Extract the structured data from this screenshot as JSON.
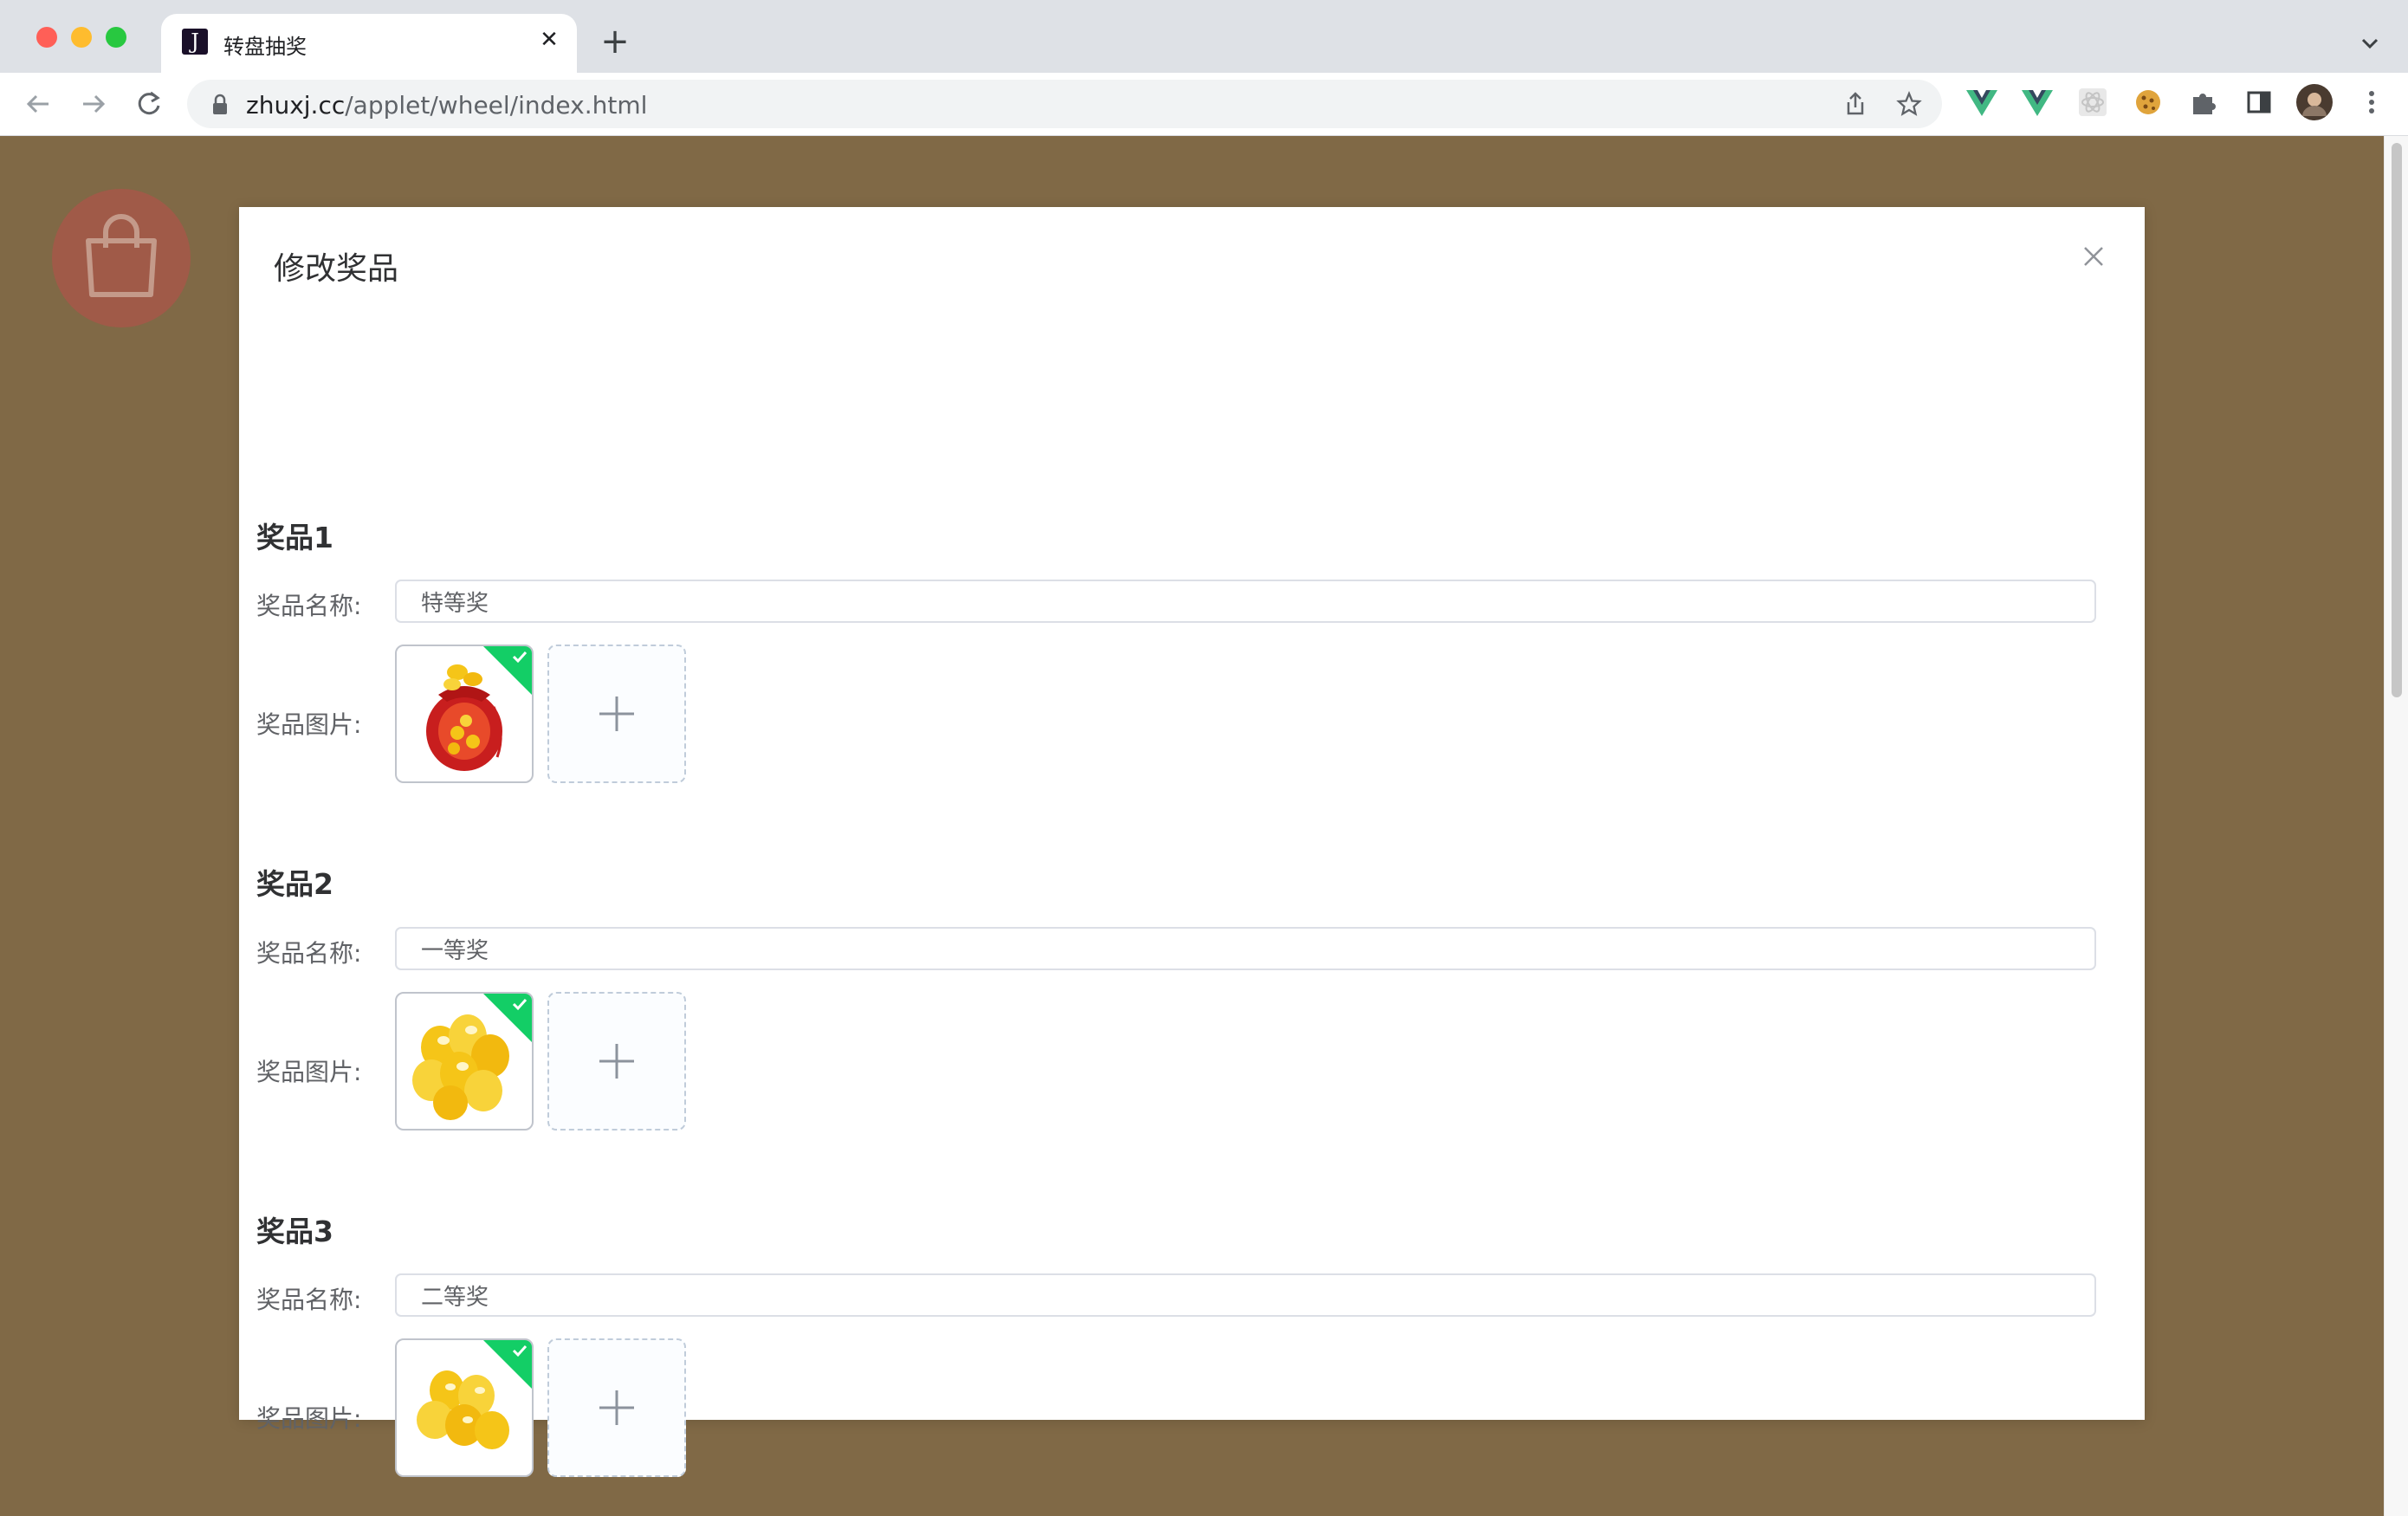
{
  "browser": {
    "tab_title": "转盘抽奖",
    "tab_favicon_letter": "J",
    "url_host": "zhuxj.cc",
    "url_path": "/applet/wheel/index.html"
  },
  "page": {
    "background_color": "#806946",
    "accent_color": "#13ce66"
  },
  "modal": {
    "title": "修改奖品",
    "prizes": [
      {
        "heading": "奖品1",
        "name_label": "奖品名称:",
        "name_value": "特等奖",
        "image_label": "奖品图片:",
        "image_icon": "red-lucky-bag-icon"
      },
      {
        "heading": "奖品2",
        "name_label": "奖品名称:",
        "name_value": "一等奖",
        "image_label": "奖品图片:",
        "image_icon": "gold-ingots-icon"
      },
      {
        "heading": "奖品3",
        "name_label": "奖品名称:",
        "name_value": "二等奖",
        "image_label": "奖品图片:",
        "image_icon": "gold-ingots-icon"
      }
    ]
  }
}
